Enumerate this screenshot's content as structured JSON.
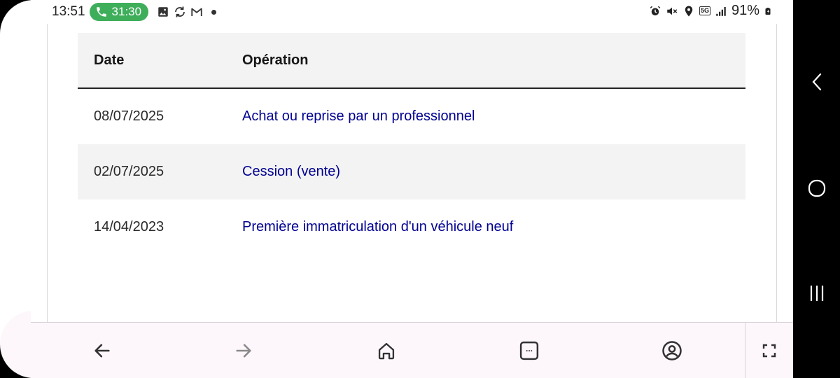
{
  "status_bar": {
    "time": "13:51",
    "call_timer": "31:30",
    "network": "5G",
    "battery": "91%",
    "icons_left": [
      "phone-icon",
      "gallery-icon",
      "sync-icon",
      "gmail-icon",
      "notification-dot-icon"
    ],
    "icons_right": [
      "alarm-icon",
      "mute-icon",
      "location-icon",
      "5g-icon",
      "signal-icon",
      "battery-icon"
    ]
  },
  "table": {
    "headers": {
      "date": "Date",
      "operation": "Opération"
    },
    "rows": [
      {
        "date": "08/07/2025",
        "operation": "Achat ou reprise par un professionnel"
      },
      {
        "date": "02/07/2025",
        "operation": "Cession (vente)"
      },
      {
        "date": "14/04/2023",
        "operation": "Première immatriculation d'un véhicule neuf"
      }
    ]
  },
  "colors": {
    "link": "#000091",
    "header_bg": "#f3f3f3",
    "call_pill": "#3fae5b",
    "toolbar_bg": "#fdf7fb"
  },
  "toolbar": {
    "buttons": [
      "back-arrow-icon",
      "forward-arrow-icon",
      "home-icon",
      "tabs-icon",
      "profile-icon",
      "fullscreen-icon"
    ],
    "tabs_label": "..."
  },
  "navbar": {
    "buttons": [
      "back-icon",
      "home-circle-icon",
      "recents-icon"
    ]
  }
}
